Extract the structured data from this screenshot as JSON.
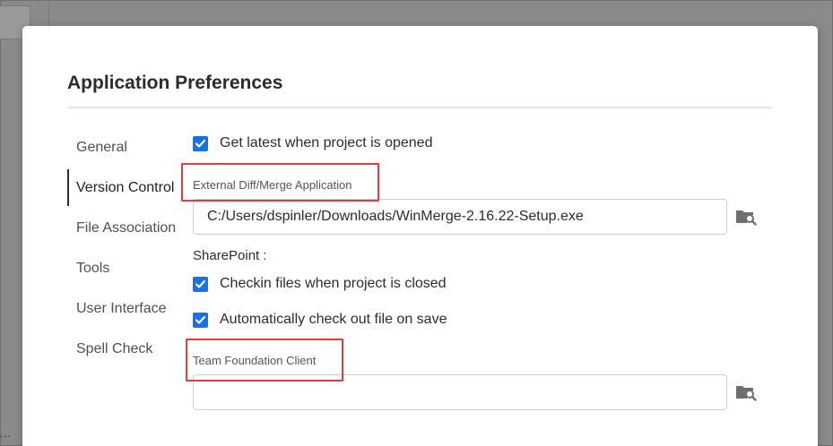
{
  "dialog": {
    "title": "Application Preferences"
  },
  "nav": {
    "items": [
      {
        "label": "General",
        "active": false
      },
      {
        "label": "Version Control",
        "active": true
      },
      {
        "label": "File Association",
        "active": false
      },
      {
        "label": "Tools",
        "active": false
      },
      {
        "label": "User Interface",
        "active": false
      },
      {
        "label": "Spell Check",
        "active": false
      }
    ]
  },
  "version_control": {
    "get_latest": {
      "label": "Get latest when project is opened",
      "checked": true
    },
    "diff_merge": {
      "label": "External Diff/Merge Application",
      "value": "C:/Users/dspinler/Downloads/WinMerge-2.16.22-Setup.exe",
      "browse_icon": "folder-search-icon"
    },
    "sharepoint": {
      "label": "SharePoint :",
      "checkin": {
        "label": "Checkin files when project is closed",
        "checked": true
      },
      "checkout": {
        "label": "Automatically check out file on save",
        "checked": true
      }
    },
    "team_foundation": {
      "label": "Team Foundation Client",
      "value": "",
      "browse_icon": "folder-search-icon"
    }
  },
  "colors": {
    "accent": "#1473e6",
    "highlight": "#e23c3c"
  },
  "background": {
    "ellipsis": "..."
  }
}
